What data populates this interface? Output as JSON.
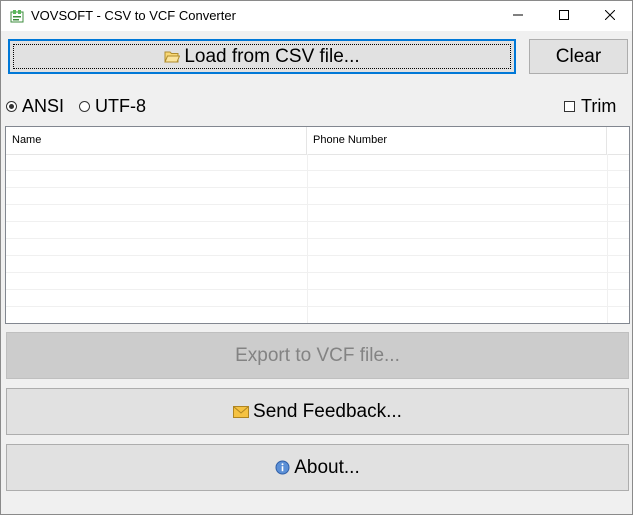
{
  "window": {
    "title": "VOVSOFT - CSV to VCF Converter"
  },
  "toolbar": {
    "load_label": "Load from CSV file...",
    "clear_label": "Clear"
  },
  "encoding": {
    "options": [
      "ANSI",
      "UTF-8"
    ],
    "selected": "ANSI",
    "trim_label": "Trim",
    "trim_checked": false
  },
  "table": {
    "columns": [
      "Name",
      "Phone Number"
    ],
    "rows": []
  },
  "actions": {
    "export_label": "Export to VCF file...",
    "export_enabled": false,
    "feedback_label": "Send Feedback...",
    "about_label": "About..."
  },
  "colors": {
    "focus_border": "#0078d7",
    "button_face": "#e1e1e1",
    "disabled_text": "#838383"
  }
}
